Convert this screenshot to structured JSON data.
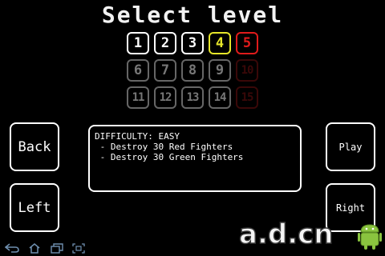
{
  "title": "Select level",
  "levels": [
    {
      "label": "1",
      "state": "unlocked"
    },
    {
      "label": "2",
      "state": "unlocked"
    },
    {
      "label": "3",
      "state": "unlocked"
    },
    {
      "label": "4",
      "state": "selected"
    },
    {
      "label": "5",
      "state": "hard"
    },
    {
      "label": "6",
      "state": "locked"
    },
    {
      "label": "7",
      "state": "locked"
    },
    {
      "label": "8",
      "state": "locked"
    },
    {
      "label": "9",
      "state": "locked"
    },
    {
      "label": "10",
      "state": "hard-locked"
    },
    {
      "label": "11",
      "state": "locked"
    },
    {
      "label": "12",
      "state": "locked"
    },
    {
      "label": "13",
      "state": "locked"
    },
    {
      "label": "14",
      "state": "locked"
    },
    {
      "label": "15",
      "state": "hard-locked"
    }
  ],
  "buttons": {
    "back": "Back",
    "left": "Left",
    "play": "Play",
    "right": "Right"
  },
  "info": {
    "difficulty": "DIFFICULTY: EASY",
    "objectives": [
      " - Destroy 30 Red Fighters",
      " - Destroy 30 Green Fighters"
    ]
  },
  "watermark": {
    "text": "a.d.cn"
  },
  "colors": {
    "background": "#000000",
    "selected": "#e6e62a",
    "hard": "#e01b1b",
    "locked": "#666666"
  },
  "icons": {
    "nav_back": "back-arrow-icon",
    "nav_home": "home-icon",
    "nav_recent": "recent-apps-icon",
    "nav_capture": "screenshot-icon",
    "watermark_logo": "android-robot-icon"
  }
}
